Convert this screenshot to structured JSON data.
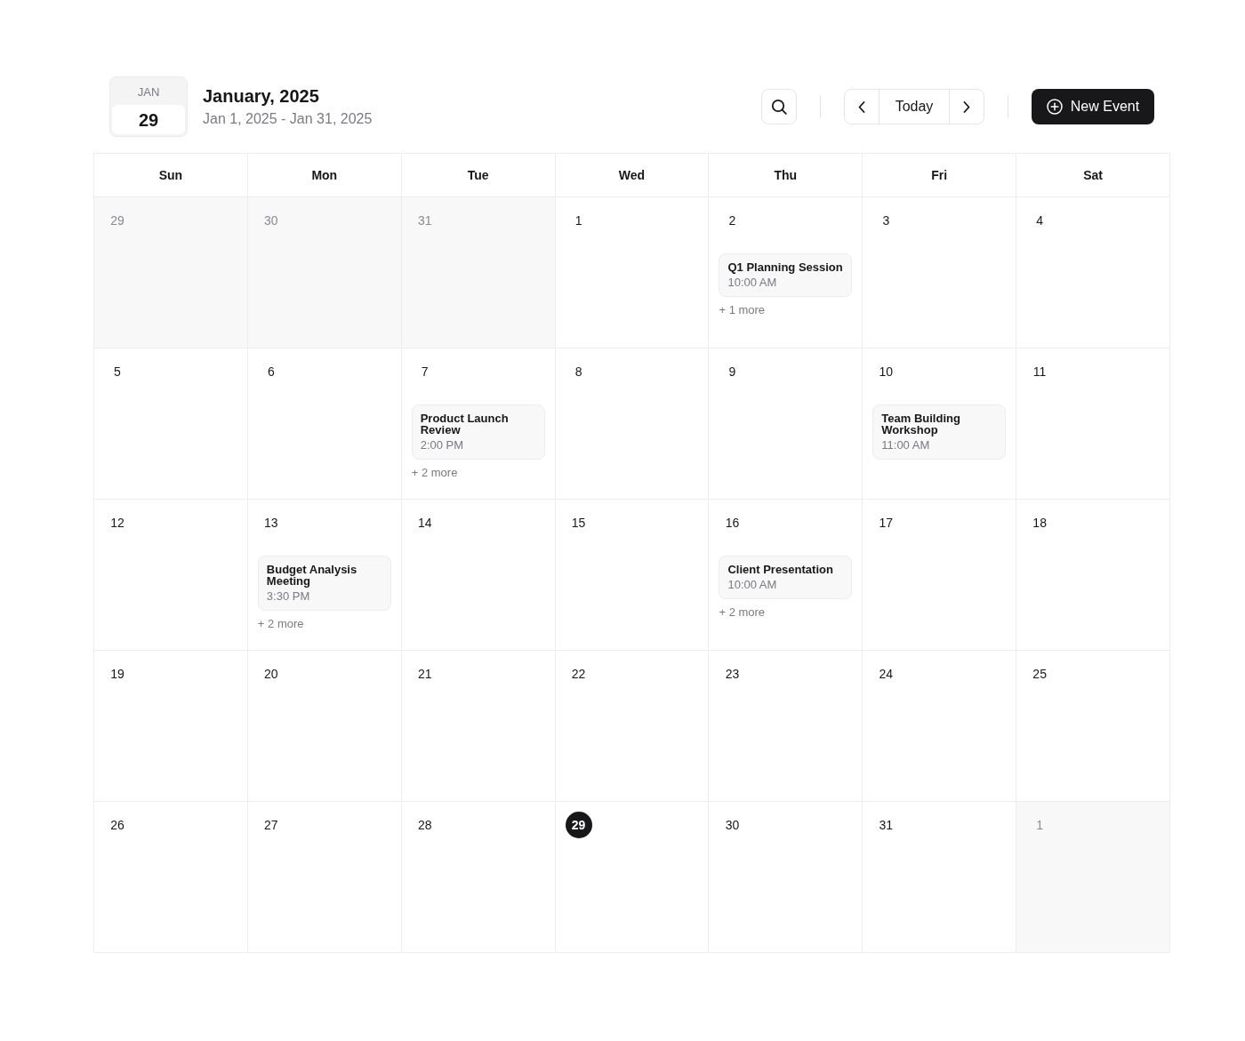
{
  "header": {
    "badge_month": "JAN",
    "badge_day": "29",
    "title": "January, 2025",
    "range": "Jan 1, 2025 - Jan 31, 2025"
  },
  "toolbar": {
    "today_label": "Today",
    "new_event_label": "New Event"
  },
  "weekdays": [
    "Sun",
    "Mon",
    "Tue",
    "Wed",
    "Thu",
    "Fri",
    "Sat"
  ],
  "days": [
    {
      "day": "29",
      "in_month": false,
      "today": false
    },
    {
      "day": "30",
      "in_month": false,
      "today": false
    },
    {
      "day": "31",
      "in_month": false,
      "today": false
    },
    {
      "day": "1",
      "in_month": true,
      "today": false
    },
    {
      "day": "2",
      "in_month": true,
      "today": false,
      "events": [
        {
          "title": "Q1 Planning Session",
          "time": "10:00 AM"
        }
      ],
      "more": "+ 1 more"
    },
    {
      "day": "3",
      "in_month": true,
      "today": false
    },
    {
      "day": "4",
      "in_month": true,
      "today": false
    },
    {
      "day": "5",
      "in_month": true,
      "today": false
    },
    {
      "day": "6",
      "in_month": true,
      "today": false
    },
    {
      "day": "7",
      "in_month": true,
      "today": false,
      "events": [
        {
          "title": "Product Launch Review",
          "time": "2:00 PM"
        }
      ],
      "more": "+ 2 more"
    },
    {
      "day": "8",
      "in_month": true,
      "today": false
    },
    {
      "day": "9",
      "in_month": true,
      "today": false
    },
    {
      "day": "10",
      "in_month": true,
      "today": false,
      "events": [
        {
          "title": "Team Building Workshop",
          "time": "11:00 AM"
        }
      ]
    },
    {
      "day": "11",
      "in_month": true,
      "today": false
    },
    {
      "day": "12",
      "in_month": true,
      "today": false
    },
    {
      "day": "13",
      "in_month": true,
      "today": false,
      "events": [
        {
          "title": "Budget Analysis Meeting",
          "time": "3:30 PM"
        }
      ],
      "more": "+ 2 more"
    },
    {
      "day": "14",
      "in_month": true,
      "today": false
    },
    {
      "day": "15",
      "in_month": true,
      "today": false
    },
    {
      "day": "16",
      "in_month": true,
      "today": false,
      "events": [
        {
          "title": "Client Presentation",
          "time": "10:00 AM"
        }
      ],
      "more": "+ 2 more"
    },
    {
      "day": "17",
      "in_month": true,
      "today": false
    },
    {
      "day": "18",
      "in_month": true,
      "today": false
    },
    {
      "day": "19",
      "in_month": true,
      "today": false
    },
    {
      "day": "20",
      "in_month": true,
      "today": false
    },
    {
      "day": "21",
      "in_month": true,
      "today": false
    },
    {
      "day": "22",
      "in_month": true,
      "today": false
    },
    {
      "day": "23",
      "in_month": true,
      "today": false
    },
    {
      "day": "24",
      "in_month": true,
      "today": false
    },
    {
      "day": "25",
      "in_month": true,
      "today": false
    },
    {
      "day": "26",
      "in_month": true,
      "today": false
    },
    {
      "day": "27",
      "in_month": true,
      "today": false
    },
    {
      "day": "28",
      "in_month": true,
      "today": false
    },
    {
      "day": "29",
      "in_month": true,
      "today": true
    },
    {
      "day": "30",
      "in_month": true,
      "today": false
    },
    {
      "day": "31",
      "in_month": true,
      "today": false
    },
    {
      "day": "1",
      "in_month": false,
      "today": false
    }
  ]
}
